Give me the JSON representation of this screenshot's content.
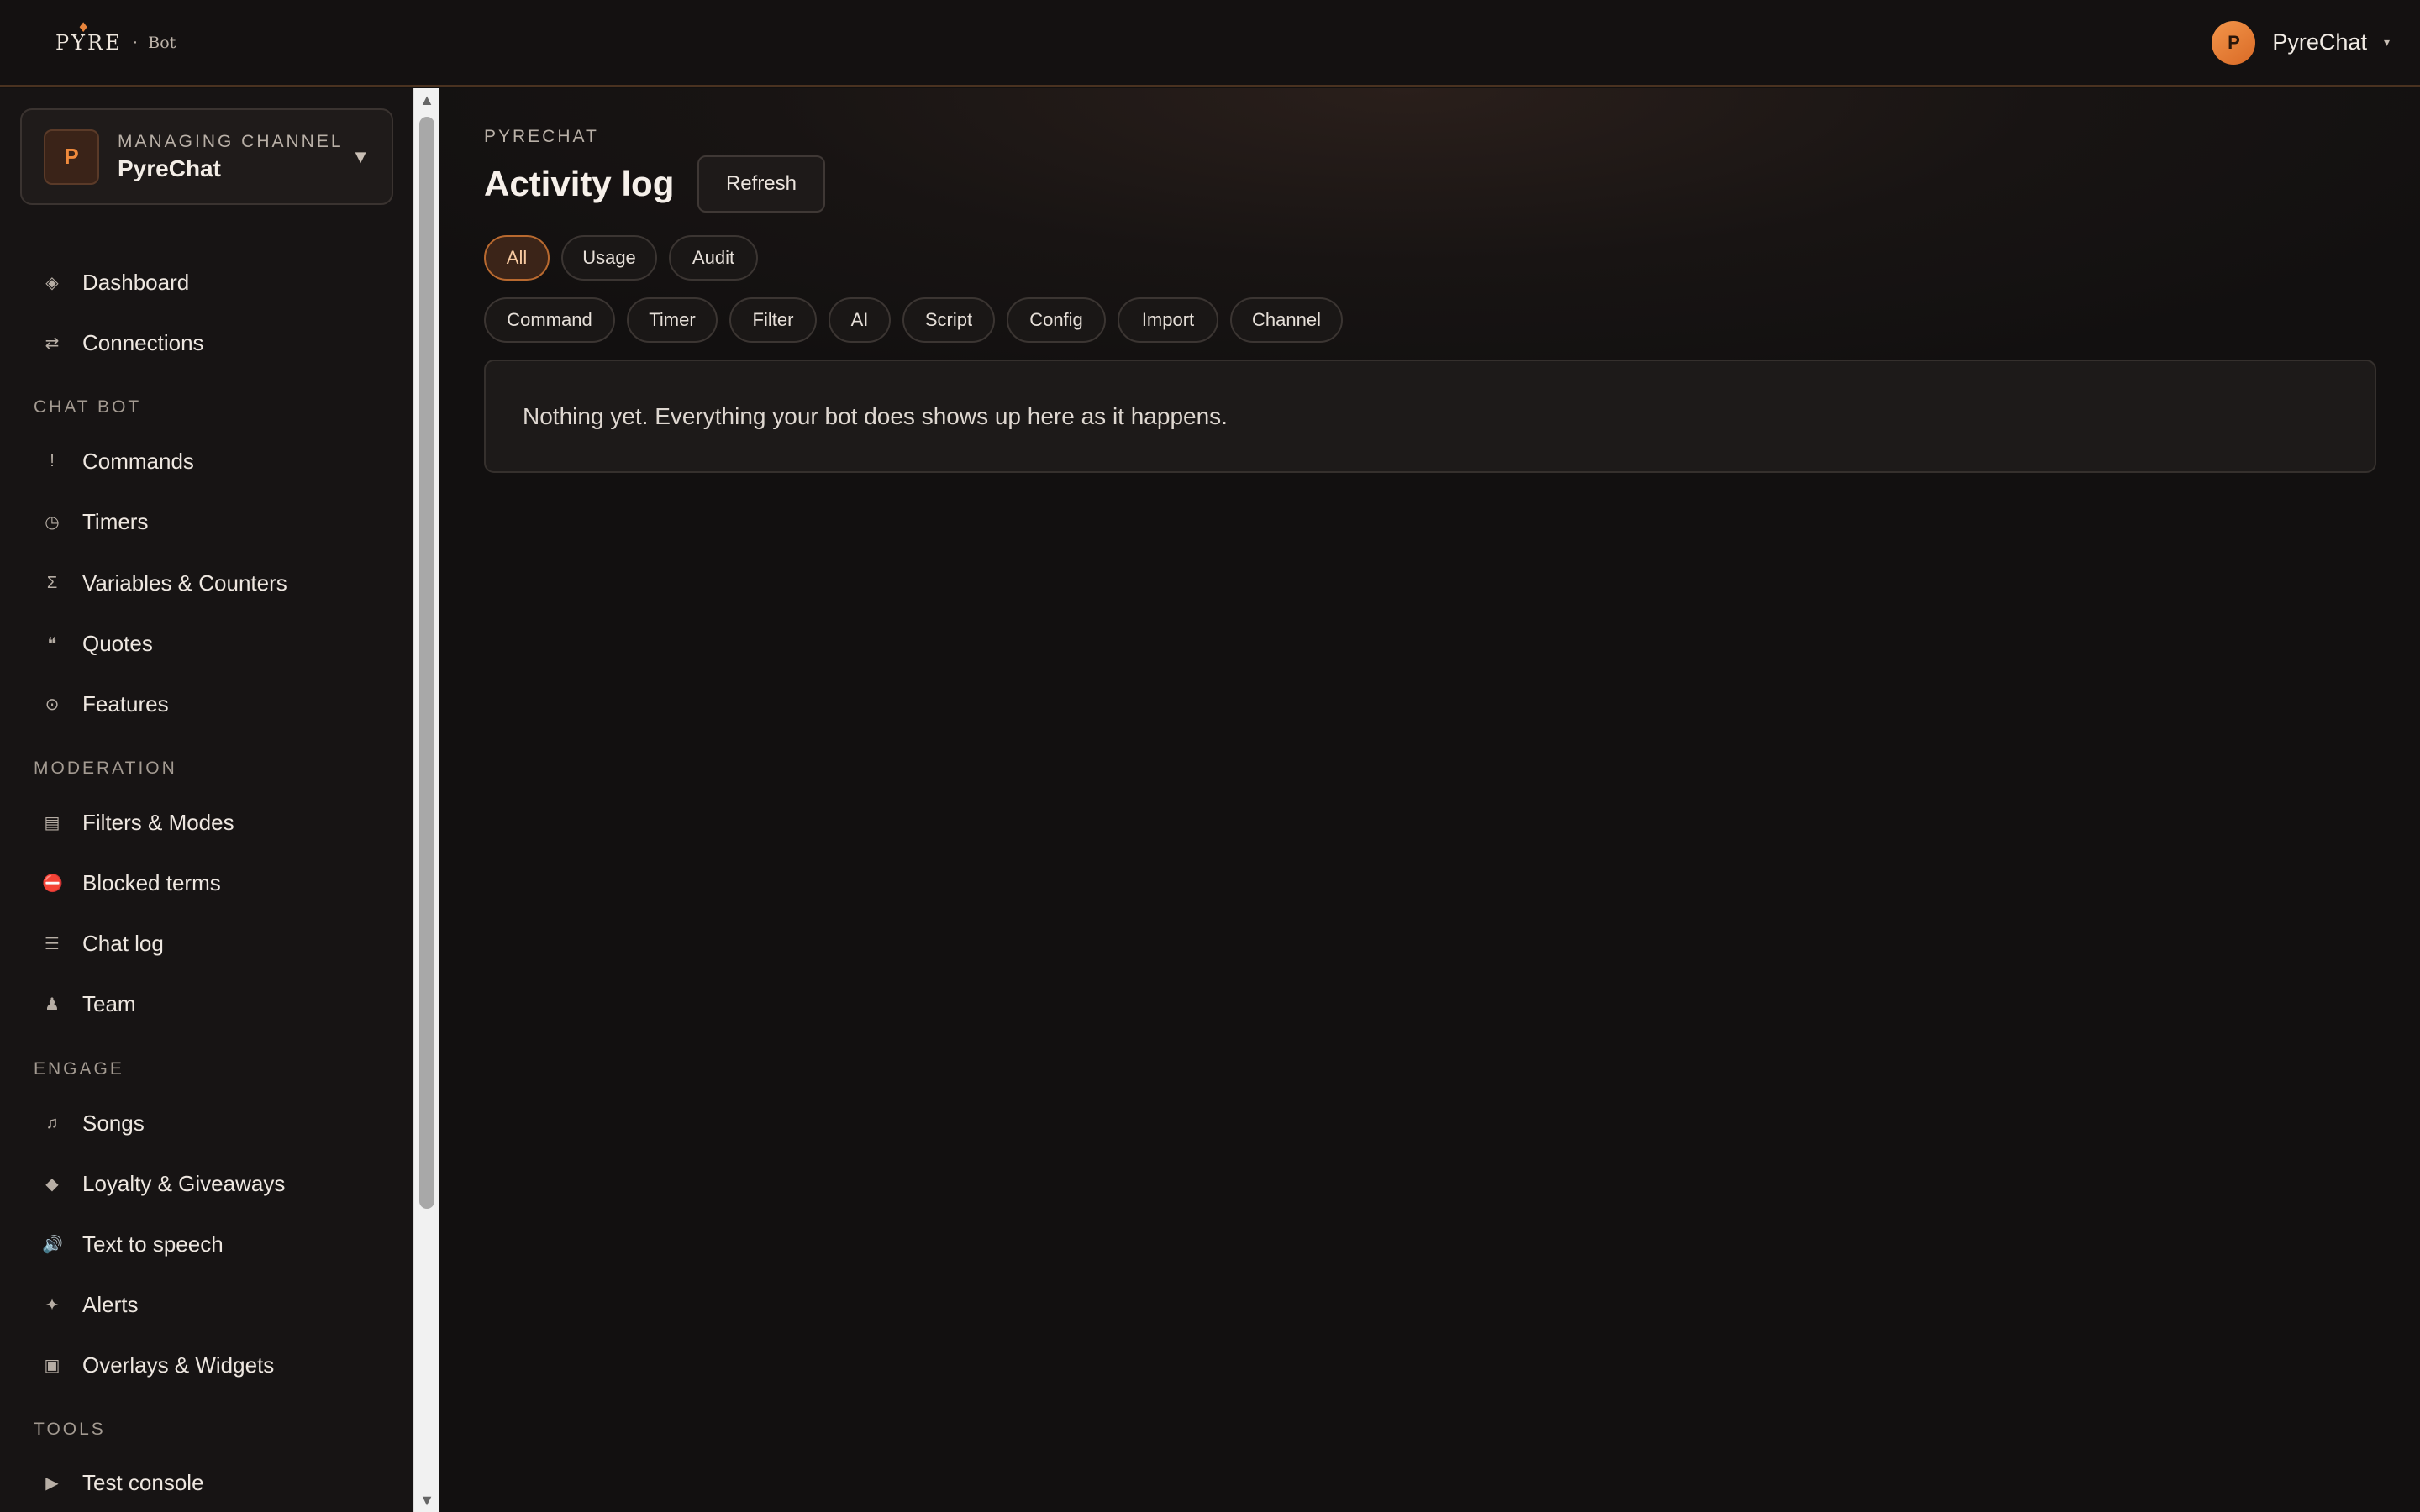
{
  "header": {
    "logo_word": "PYRE",
    "logo_sep": "·",
    "logo_suffix": "Bot",
    "user_initial": "P",
    "user_name": "PyreChat"
  },
  "sidebar": {
    "channel_label": "MANAGING CHANNEL",
    "channel_name": "PyreChat",
    "channel_initial": "P",
    "items_top": [
      {
        "label": "Dashboard",
        "icon": "◈"
      },
      {
        "label": "Connections",
        "icon": "⇄"
      }
    ],
    "sections": [
      {
        "title": "CHAT BOT",
        "items": [
          {
            "label": "Commands",
            "icon": "!"
          },
          {
            "label": "Timers",
            "icon": "◷"
          },
          {
            "label": "Variables & Counters",
            "icon": "Σ"
          },
          {
            "label": "Quotes",
            "icon": "❝"
          },
          {
            "label": "Features",
            "icon": "⊙"
          }
        ]
      },
      {
        "title": "MODERATION",
        "items": [
          {
            "label": "Filters & Modes",
            "icon": "▤"
          },
          {
            "label": "Blocked terms",
            "icon": "⛔"
          },
          {
            "label": "Chat log",
            "icon": "☰"
          },
          {
            "label": "Team",
            "icon": "♟"
          }
        ]
      },
      {
        "title": "ENGAGE",
        "items": [
          {
            "label": "Songs",
            "icon": "♫"
          },
          {
            "label": "Loyalty & Giveaways",
            "icon": "◆"
          },
          {
            "label": "Text to speech",
            "icon": "🔊"
          },
          {
            "label": "Alerts",
            "icon": "✦"
          },
          {
            "label": "Overlays & Widgets",
            "icon": "▣"
          }
        ]
      },
      {
        "title": "TOOLS",
        "items": [
          {
            "label": "Test console",
            "icon": "▶"
          }
        ]
      }
    ]
  },
  "main": {
    "breadcrumb": "PYRECHAT",
    "title": "Activity log",
    "refresh_label": "Refresh",
    "primary_filters": [
      {
        "label": "All",
        "active": true
      },
      {
        "label": "Usage",
        "active": false
      },
      {
        "label": "Audit",
        "active": false
      }
    ],
    "category_filters": [
      "Command",
      "Timer",
      "Filter",
      "AI",
      "Script",
      "Config",
      "Import",
      "Channel"
    ],
    "empty_message": "Nothing yet. Everything your bot does shows up here as it happens."
  },
  "colors": {
    "accent": "#e8843c",
    "background": "#121010",
    "sidebar": "#171414"
  }
}
